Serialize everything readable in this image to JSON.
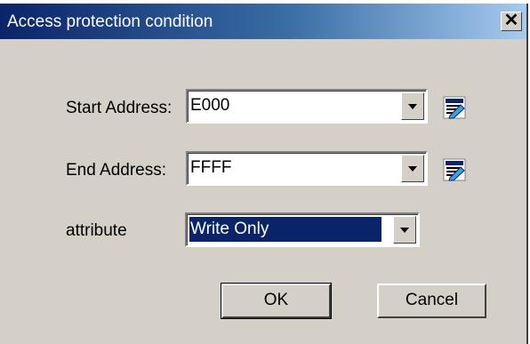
{
  "window": {
    "title": "Access protection condition",
    "close_label": "✕"
  },
  "form": {
    "start": {
      "label": "Start Address:",
      "value": "E000"
    },
    "end": {
      "label": "End Address:",
      "value": "FFFF"
    },
    "attribute": {
      "label": "attribute",
      "value": "Write Only"
    }
  },
  "buttons": {
    "ok": "OK",
    "cancel": "Cancel"
  },
  "icons": {
    "browse": "memory-browse-icon"
  }
}
